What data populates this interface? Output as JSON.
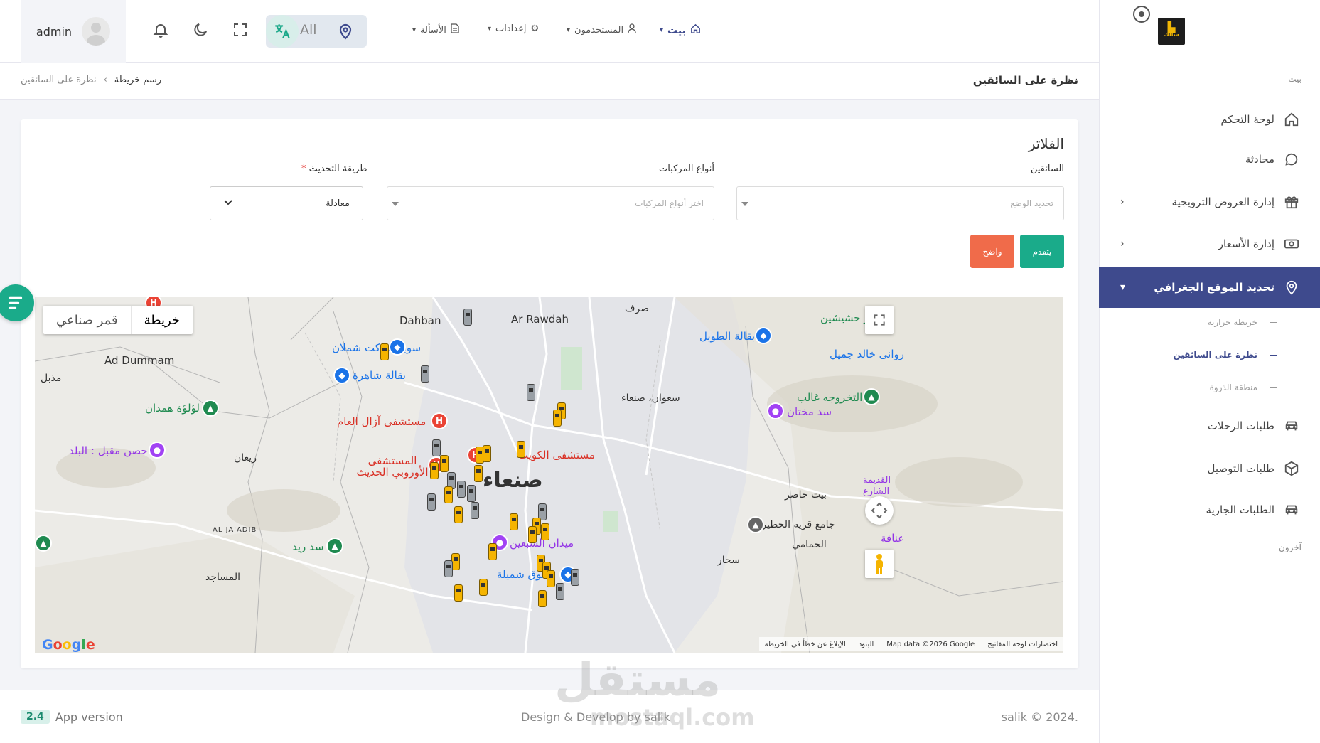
{
  "header": {
    "user_name": "admin",
    "lang_all": "All",
    "nav": {
      "home": "بيت",
      "users": "المستخدمون",
      "settings": "إعدادات",
      "faq": "الأسألة"
    }
  },
  "titlebar": {
    "title": "نظرة على السائقين",
    "breadcrumb_current": "رسم خريطة",
    "breadcrumb_parent": "نظرة على السائقين"
  },
  "sidebar": {
    "logo_text": "سالك",
    "section_home": "بيت",
    "section_other": "آخرون",
    "items": [
      {
        "label": "لوحة التحكم",
        "icon": "home-icon"
      },
      {
        "label": "محادثة",
        "icon": "chat-icon"
      },
      {
        "label": "إدارة العروض الترويجية",
        "icon": "gift-icon"
      },
      {
        "label": "إدارة الأسعار",
        "icon": "money-icon"
      },
      {
        "label": "تحديد الموقع الجغرافي",
        "icon": "map-pin-icon"
      },
      {
        "label": "طلبات الرحلات",
        "icon": "car-icon"
      },
      {
        "label": "طلبات التوصيل",
        "icon": "box-icon"
      },
      {
        "label": "الطلبات الجارية",
        "icon": "car-icon"
      }
    ],
    "sub_items": [
      {
        "label": "خريطة حرارية"
      },
      {
        "label": "نظرة على السائقين"
      },
      {
        "label": "منطقة الذروة"
      }
    ]
  },
  "filters": {
    "title": "الفلاتر",
    "drivers_label": "السائقين",
    "drivers_placeholder": "تحديد الوضع",
    "vehicle_types_label": "أنواع المركبات",
    "vehicle_types_placeholder": "اختر أنواع المركبات",
    "update_method_label": "طريقة التحديث",
    "update_method_required": "*",
    "update_method_value": "معادلة",
    "submit_label": "يتقدم",
    "clear_label": "واضح"
  },
  "map": {
    "type_map": "خريطة",
    "type_satellite": "قمر صناعي",
    "city_label": "صنعاء",
    "labels": {
      "dahban": "Dahban",
      "ar_rawdah": "Ar Rawdah",
      "ad_dummam": "Ad Dummam",
      "al_jaadib": "AL JA'ADIB",
      "sarf": "صرف",
      "mudhil": "مذبل",
      "rayan": "ريعان",
      "masajid": "المساجد",
      "sawan": "سعوان، صنعاء",
      "bayt_hadir": "بيت حاضر",
      "sahar": "سحار",
      "hamami": "الحمامي",
      "lulua": "لؤلؤة همدان",
      "sad_rayd": "سد ريد",
      "hisn": "حصن مقبل : البلد",
      "tawil": "بقالة الطويل",
      "shamlan": "سوبر ماركت شملان",
      "shahera": "بقالة شاهرة",
      "azal": "مستشفى آزال العام",
      "european": "المستشفى الأوروبي الحديث",
      "kuwait": "مستشفى الكويت",
      "sabeen": "ميدان السبعين",
      "shumaila": "سوق شميلة",
      "khalid": "روانى خالد جميل",
      "hashishin": "بئر حشيشين",
      "ghalib": "التخروجه غالب",
      "mokhtan": "سد مختان",
      "hadhira": "جامع قرية الحظيرة",
      "anafa": "عنافة",
      "qadima": "القديمة الشارع",
      "attrib_shortcuts": "اختصارات لوحة المفاتيح",
      "attrib_data": "Map data ©2026 Google",
      "attrib_terms": "البنود",
      "attrib_report": "الإبلاغ عن خطأ في الخريطة",
      "google": "Google"
    }
  },
  "footer": {
    "version_number": "2.4",
    "version_label": "App version",
    "credit": "Design & Develop by salik",
    "copyright": "salik © 2024."
  },
  "watermark": {
    "arabic": "مستقل",
    "latin": "mostaql.com"
  },
  "colors": {
    "primary": "#3e4a8d",
    "accent_green": "#1aab8a",
    "clear_button": "#f06b4a"
  }
}
